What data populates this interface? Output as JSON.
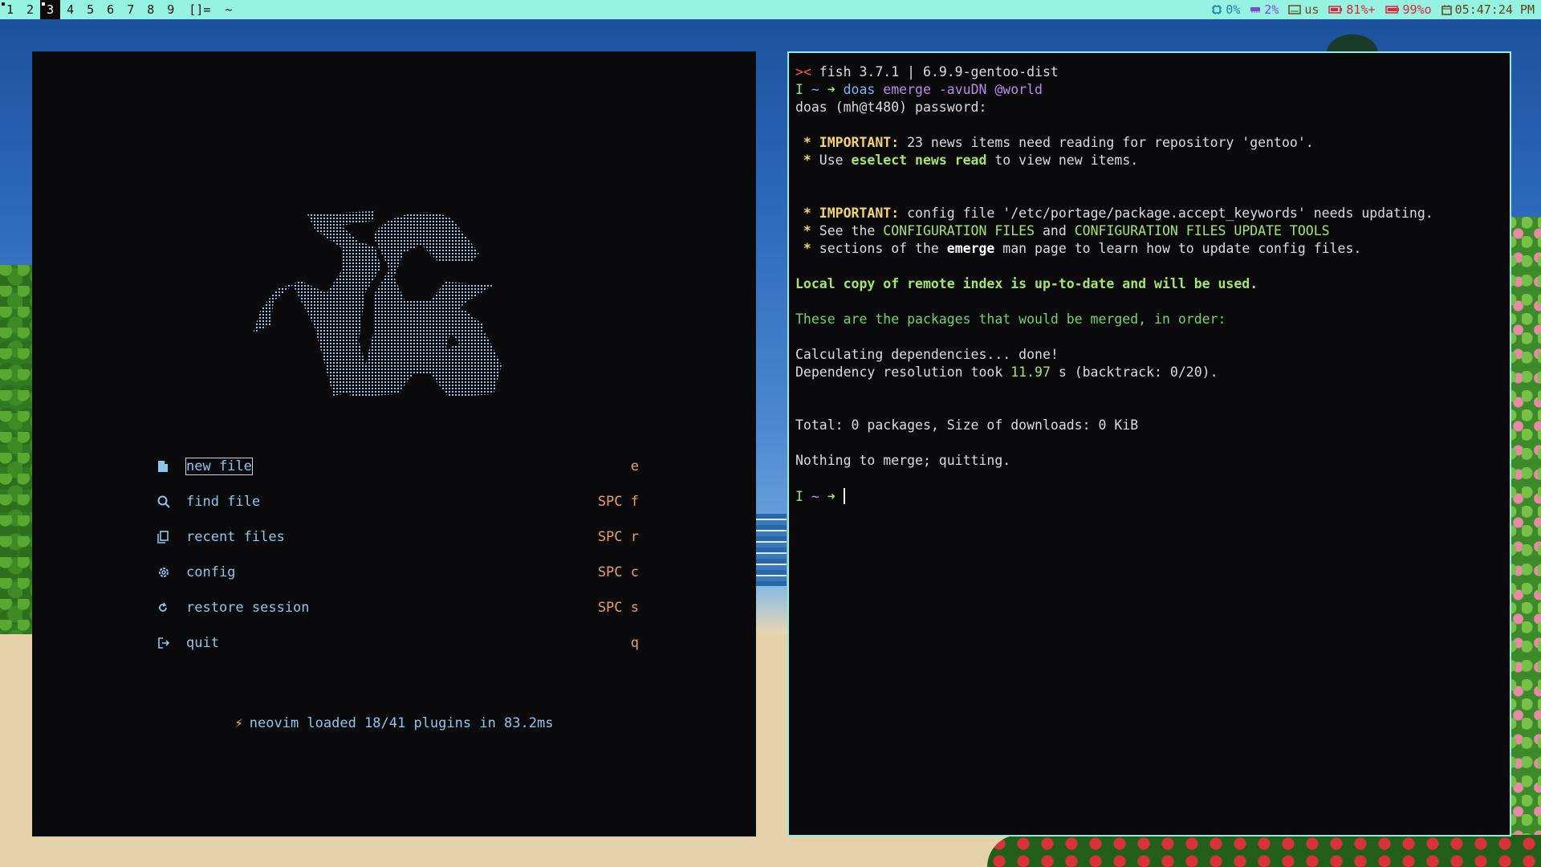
{
  "topbar": {
    "workspaces": [
      {
        "label": "1",
        "occupied": true,
        "active": false
      },
      {
        "label": "2",
        "occupied": false,
        "active": false
      },
      {
        "label": "3",
        "occupied": true,
        "active": true
      },
      {
        "label": "4",
        "occupied": false,
        "active": false
      },
      {
        "label": "5",
        "occupied": false,
        "active": false
      },
      {
        "label": "6",
        "occupied": false,
        "active": false
      },
      {
        "label": "7",
        "occupied": false,
        "active": false
      },
      {
        "label": "8",
        "occupied": false,
        "active": false
      },
      {
        "label": "9",
        "occupied": false,
        "active": false
      }
    ],
    "layout_symbol": "[]=",
    "window_title": "~",
    "status": {
      "cpu": "0%",
      "mem": "2%",
      "keyboard": "us",
      "battery1": "81%+",
      "battery2": "99%o",
      "clock": "05:47:24 PM"
    }
  },
  "nvim": {
    "menu": [
      {
        "icon": "file-icon",
        "label": "new file",
        "key": "e"
      },
      {
        "icon": "search-icon",
        "label": "find file",
        "key": "SPC f"
      },
      {
        "icon": "copy-icon",
        "label": "recent files",
        "key": "SPC r"
      },
      {
        "icon": "gear-icon",
        "label": "config",
        "key": "SPC c"
      },
      {
        "icon": "restore-icon",
        "label": "restore session",
        "key": "SPC s"
      },
      {
        "icon": "exit-icon",
        "label": "quit",
        "key": "q"
      }
    ],
    "loaded_bolt": "⚡",
    "loaded_text": "neovim loaded 18/41 plugins in 83.2ms"
  },
  "terminal": {
    "l1_prompt": "><",
    "l1_text": " fish 3.7.1 | 6.9.9-gentoo-dist",
    "l2_mode": "I",
    "l2_path": " ~ ",
    "l2_arrow": "➜",
    "l2_cmd": " doas",
    "l2_args": " emerge -avuDN",
    "l2_world": " @world",
    "l3": "doas (mh@t480) password:",
    "star": " *",
    "l5_imp": " IMPORTANT:",
    "l5_rest": " 23 news items need reading for repository 'gentoo'.",
    "l6_a": " Use ",
    "l6_b": "eselect news read",
    "l6_c": " to view new items.",
    "l9_imp": " IMPORTANT:",
    "l9_rest": " config file '/etc/portage/package.accept_keywords' needs updating.",
    "l10_a": " See the ",
    "l10_b": "CONFIGURATION FILES",
    "l10_c": " and ",
    "l10_d": "CONFIGURATION FILES UPDATE TOOLS",
    "l11_a": " sections of the ",
    "l11_b": "emerge",
    "l11_c": " man page to learn how to update config files.",
    "l13": "Local copy of remote index is up-to-date and will be used.",
    "l15": "These are the packages that would be merged, in order:",
    "l17": "Calculating dependencies... done!",
    "l18_a": "Dependency resolution took ",
    "l18_b": "11.97",
    "l18_c": " s (backtrack: 0/20).",
    "l21": "Total: 0 packages, Size of downloads: 0 KiB",
    "l23": "Nothing to merge; quitting.",
    "l25_mode": "I",
    "l25_path": " ~ ",
    "l25_arrow": "➜"
  }
}
